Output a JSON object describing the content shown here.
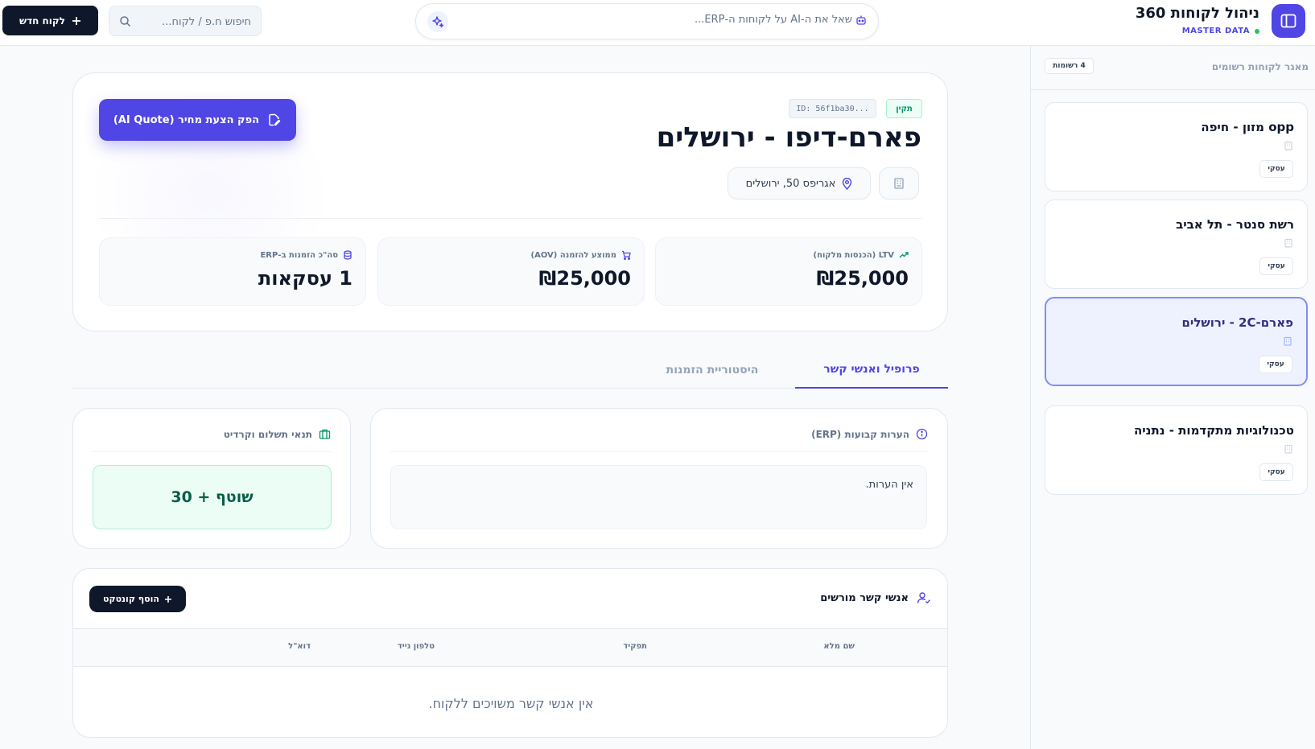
{
  "header": {
    "app_title": "ניהול לקוחות 360",
    "app_subtitle": "MASTER DATA",
    "ai_prompt": "שאל את ה-AI על לקוחות ה-ERP...",
    "search_placeholder": "חיפוש ח.פ / לקוח...",
    "new_customer_label": "לקוח חדש",
    "icons": [
      "sidebar-toggle-icon",
      "sparkle-icon",
      "ai-bot-icon",
      "search-icon",
      "plus-icon"
    ]
  },
  "sidebar": {
    "title": "מאגר לקוחות רשומים",
    "count_label": "4 רשומות",
    "customers": [
      {
        "name": "opp מזון - חיפה",
        "tag": "עסקי",
        "active": false
      },
      {
        "name": "רשת סנטר - תל אביב",
        "tag": "עסקי",
        "active": false
      },
      {
        "name": "פארם-2C - ירושלים",
        "tag": "עסקי",
        "active": true
      },
      {
        "name": "טכנולוגיות מתקדמות - נתניה",
        "tag": "עסקי",
        "active": false
      }
    ]
  },
  "customer": {
    "status": "תקין",
    "id_label": "ID: 56f1ba30...",
    "name": "פארם-דיפו - ירושלים",
    "address": "אגריפס 50, ירושלים",
    "quote_button": "הפק הצעת מחיר (AI Quote)"
  },
  "kpis": [
    {
      "label": "LTV (הכנסות מלקוח)",
      "value": "₪25,000",
      "icon": "trending-up-icon"
    },
    {
      "label": "ממוצע להזמנה (AOV)",
      "value": "₪25,000",
      "icon": "cart-icon"
    },
    {
      "label": "סה\"כ הזמנות ב-ERP",
      "value": "1 עסקאות",
      "icon": "database-icon"
    }
  ],
  "tabs": [
    {
      "label": "פרופיל ואנשי קשר",
      "active": true
    },
    {
      "label": "היסטוריית הזמנות",
      "active": false
    }
  ],
  "notes": {
    "title": "הערות קבועות (ERP)",
    "text": "אין הערות."
  },
  "terms": {
    "title": "תנאי תשלום וקרדיט",
    "value": "שוטף + 30"
  },
  "contacts": {
    "title": "אנשי קשר מורשים",
    "add_button": "הוסף קונטקט",
    "columns": [
      "שם מלא",
      "תפקיד",
      "טלפון נייד",
      "דוא\"ל"
    ],
    "empty_message": "אין אנשי קשר משויכים ללקוח."
  },
  "colors": {
    "accent": "#4f46e5",
    "dark": "#0f172a",
    "success": "#059669",
    "muted": "#64748b"
  }
}
